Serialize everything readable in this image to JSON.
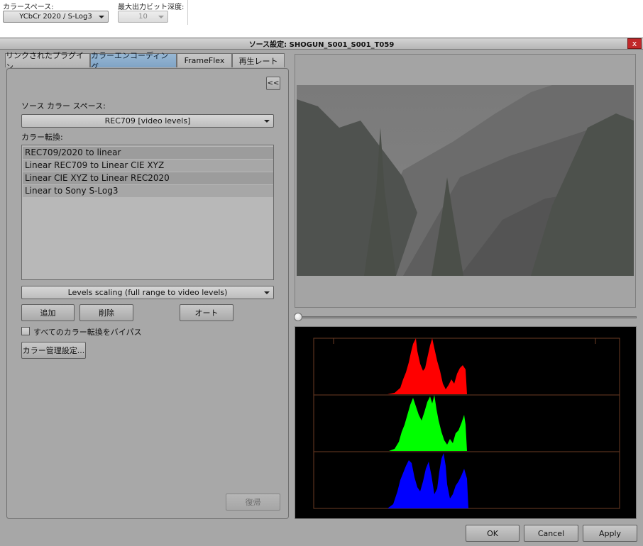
{
  "top_bar": {
    "color_space_label": "カラースペース:",
    "color_space_value": "YCbCr 2020 / S-Log3",
    "bit_depth_label": "最大出力ビット深度:",
    "bit_depth_value": "10"
  },
  "dialog": {
    "title": "ソース設定: SHOGUN_S001_S001_T059",
    "close_glyph": "x",
    "tabs": [
      {
        "label": "リンクされたプラグイン",
        "active": false
      },
      {
        "label": "カラーエンコーディング",
        "active": true
      },
      {
        "label": "FrameFlex",
        "active": false
      },
      {
        "label": "再生レート",
        "active": false
      }
    ],
    "collapse_glyph": "<<",
    "source_color_space_label": "ソース カラー スペース:",
    "source_color_space_value": "REC709 [video levels]",
    "color_transform_label": "カラー転換:",
    "transforms": [
      "REC709/2020 to linear",
      "Linear REC709 to Linear CIE XYZ",
      "Linear CIE XYZ to Linear REC2020",
      "Linear to Sony S-Log3"
    ],
    "levels_scaling_value": "Levels scaling (full range to video levels)",
    "add_button": "追加",
    "delete_button": "削除",
    "auto_button": "オート",
    "bypass_label": "すべてのカラー転換をバイパス",
    "color_mgmt_button": "カラー管理設定...",
    "restore_button": "復帰",
    "ok_button": "OK",
    "cancel_button": "Cancel",
    "apply_button": "Apply"
  },
  "colors": {
    "red": "#ff0000",
    "green": "#00ff00",
    "blue": "#0000ff",
    "tab_active": "#8fb0cf",
    "close": "#c0282a"
  }
}
